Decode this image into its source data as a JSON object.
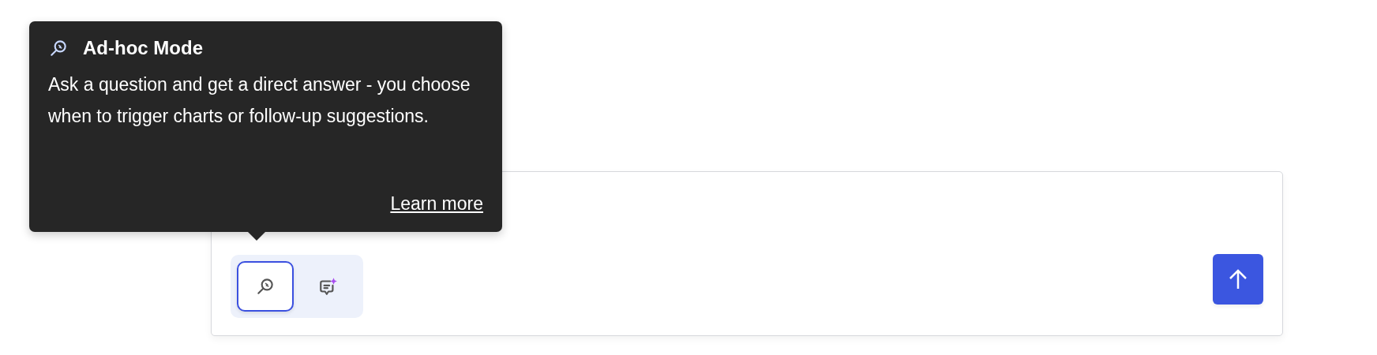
{
  "tooltip": {
    "title": "Ad-hoc Mode",
    "description": "Ask a question and get a direct answer - you choose when to trigger charts or follow-up suggestions.",
    "link": "Learn more"
  },
  "modes": [
    {
      "kind": "adhoc",
      "selected": true
    },
    {
      "kind": "assistant",
      "selected": false
    }
  ]
}
